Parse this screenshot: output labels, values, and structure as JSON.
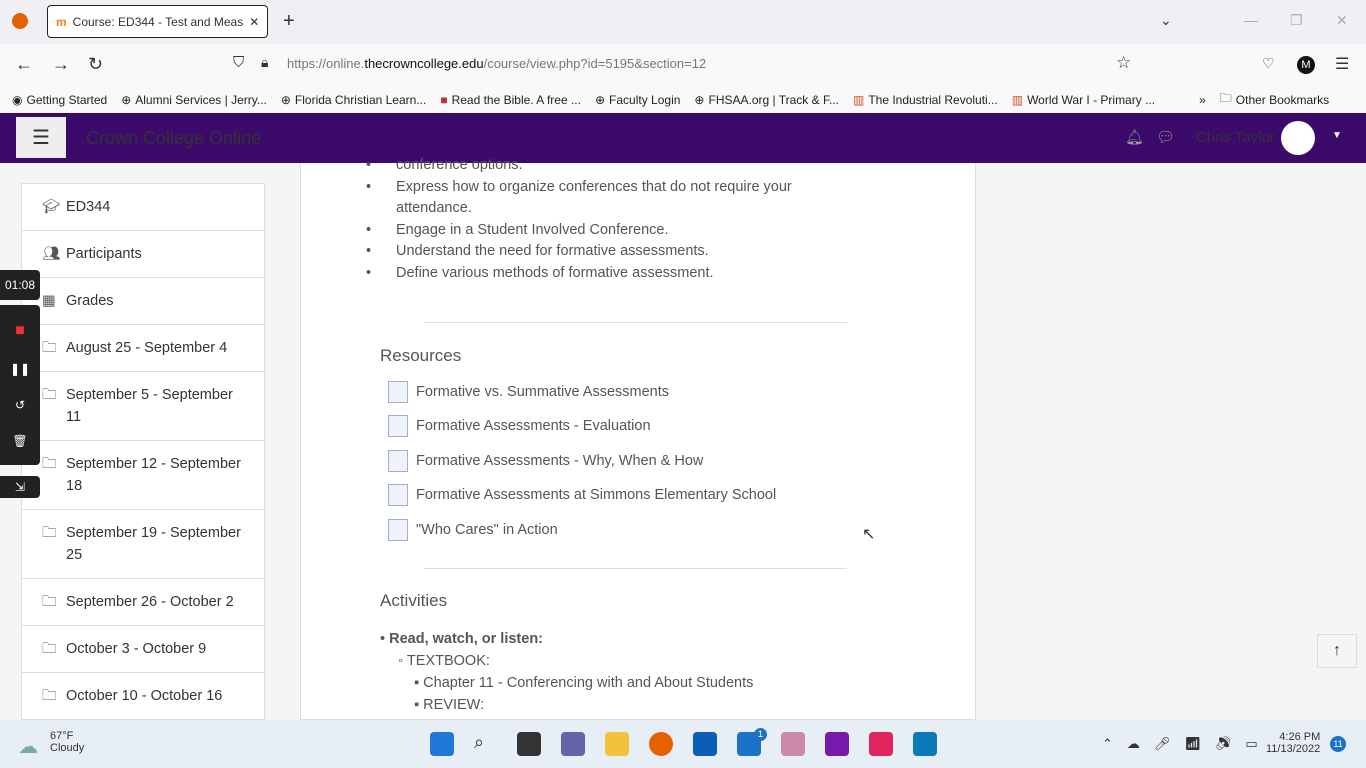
{
  "browser": {
    "tab_title": "Course: ED344 - Test and Meas",
    "url_prefix": "https://online.",
    "url_domain": "thecrowncollege.edu",
    "url_path": "/course/view.php?id=5195&section=12",
    "bookmarks": [
      "Getting Started",
      "Alumni Services | Jerry...",
      "Florida Christian Learn...",
      "Read the Bible. A free ...",
      "Faculty Login",
      "FHSAA.org | Track & F...",
      "The Industrial Revoluti...",
      "World War I - Primary ..."
    ],
    "other_bookmarks": "Other Bookmarks"
  },
  "header": {
    "site_name": "Crown College Online",
    "user_name": "Chris Taylor"
  },
  "drawer": {
    "items": [
      "ED344",
      "Participants",
      "Grades",
      "August 25 - September 4",
      "September 5 - September 11",
      "September 12 - September 18",
      "September 19 - September 25",
      "September 26 - October 2",
      "October 3 - October 9",
      "October 10 - October 16"
    ]
  },
  "recorder": {
    "time": "01:08"
  },
  "content": {
    "objectives": [
      "conference options.",
      "Express how to organize conferences that do not require your attendance.",
      "Engage in a Student Involved Conference.",
      "Understand the need for formative assessments.",
      "Define various methods of formative assessment."
    ],
    "resources_heading": "Resources",
    "resources": [
      "Formative vs. Summative Assessments",
      "Formative Assessments - Evaluation",
      "Formative Assessments - Why, When & How",
      "Formative Assessments at Simmons Elementary School",
      "\"Who Cares\" in Action"
    ],
    "activities_heading": "Activities",
    "activity_lead": "Read, watch, or listen:",
    "textbook": "TEXTBOOK:",
    "chapter": "Chapter 11 - Conferencing with and About Students",
    "review": "REVIEW:"
  },
  "taskbar": {
    "temp": "67°F",
    "weather": "Cloudy",
    "time": "4:26 PM",
    "date": "11/13/2022",
    "mail_badge": "1",
    "notif_badge": "11"
  }
}
